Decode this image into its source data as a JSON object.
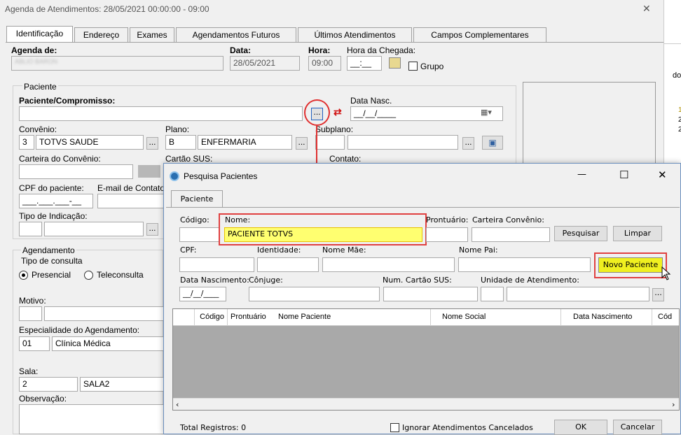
{
  "window": {
    "title": "Agenda de Atendimentos: 28/05/2021 00:00:00 - 09:00",
    "close": "✕"
  },
  "tabs": [
    "Identificação",
    "Endereço",
    "Exames",
    "Agendamentos Futuros",
    "Últimos Atendimentos",
    "Campos Complementares"
  ],
  "top": {
    "agenda_label": "Agenda de:",
    "agenda_value": "ABLIO BARON",
    "data_label": "Data:",
    "data_value": "28/05/2021",
    "hora_label": "Hora:",
    "hora_value": "09:00",
    "chegada_label": "Hora da Chegada:",
    "chegada_value": "__:__",
    "grupo": "Grupo"
  },
  "paciente": {
    "group": "Paciente",
    "label": "Paciente/Compromisso:",
    "dots": "...",
    "datanasc_label": "Data Nasc.",
    "datanasc_value": "__/__/____",
    "convenio_label": "Convênio:",
    "convenio_code": "3",
    "convenio_name": "TOTVS SAUDE",
    "plano_label": "Plano:",
    "plano_code": "B",
    "plano_name": "ENFERMARIA",
    "subplano_label": "Subplano:",
    "carteira_label": "Carteira do Convênio:",
    "sus_label": "Cartão SUS:",
    "contato_label": "Contato:",
    "cpf_label": "CPF do paciente:",
    "email_label": "E-mail de Contato:",
    "cpf_value": "___.___.___-__",
    "indicacao_label": "Tipo de Indicação:"
  },
  "agendamento": {
    "group": "Agendamento",
    "tipo_label": "Tipo de consulta",
    "presencial": "Presencial",
    "teleconsulta": "Teleconsulta",
    "motivo_label": "Motivo:",
    "especialidade_label": "Especialidade do Agendamento:",
    "esp_code": "01",
    "esp_name": "Clínica Médica",
    "sala_label": "Sala:",
    "sala_code": "2",
    "sala_name": "SALA2",
    "obs_label": "Observação:"
  },
  "right_edge": {
    "t1": "do",
    "t2": "1",
    "t3": "2",
    "t4": "2"
  },
  "dialog": {
    "title": "Pesquisa Pacientes",
    "min": "—",
    "max": "☐",
    "close": "✕",
    "tab": "Paciente",
    "codigo_label": "Código:",
    "nome_label": "Nome:",
    "nome_value": "PACIENTE TOTVS",
    "prontuario_label": "Prontuário:",
    "carteira_label": "Carteira Convênio:",
    "pesquisar": "Pesquisar",
    "limpar": "Limpar",
    "cpf_label": "CPF:",
    "identidade_label": "Identidade:",
    "nomemae_label": "Nome Mãe:",
    "nomepai_label": "Nome Pai:",
    "novo": "Novo Paciente",
    "datanasc_label": "Data Nascimento:",
    "datanasc_value": "__/__/____",
    "conjuge_label": "Cônjuge:",
    "sus_label": "Num. Cartão SUS:",
    "unidade_label": "Unidade de Atendimento:",
    "dots": "...",
    "columns": [
      "Código",
      "Prontuário",
      "Nome Paciente",
      "Nome Social",
      "Data Nascimento",
      "Cód"
    ],
    "total": "Total Registros: 0",
    "ignorar": "Ignorar Atendimentos Cancelados",
    "ok": "OK",
    "cancelar": "Cancelar"
  }
}
